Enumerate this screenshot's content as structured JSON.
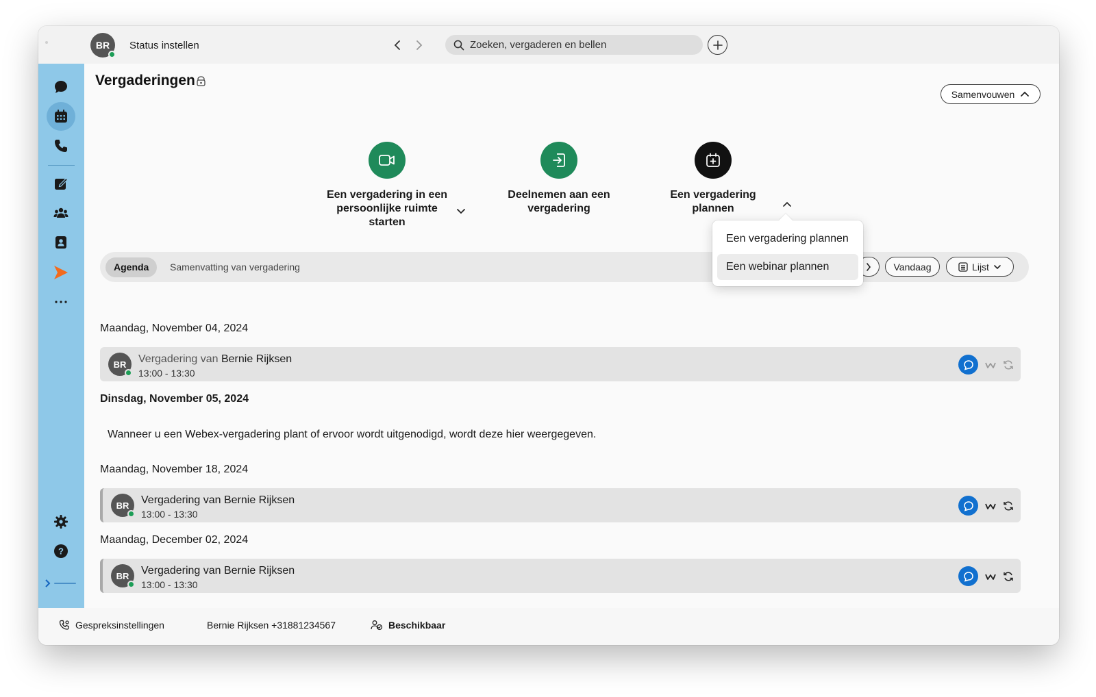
{
  "titlebar": {
    "avatar_initials": "BR",
    "status_label": "Status instellen",
    "search_placeholder": "Zoeken, vergaderen en bellen"
  },
  "sidebar": {
    "items": [
      "chat-icon",
      "calendar-icon",
      "phone-icon",
      "whiteboard-icon",
      "teams-icon",
      "contacts-icon",
      "app-icon",
      "more-icon",
      "settings-icon",
      "help-icon",
      "logo"
    ]
  },
  "page": {
    "title": "Vergaderingen",
    "collapse_label": "Samenvouwen"
  },
  "actions": [
    {
      "label": "Een vergadering in een persoonlijke ruimte starten",
      "color": "#1f8a5a"
    },
    {
      "label": "Deelnemen aan een vergadering",
      "color": "#1f8a5a"
    },
    {
      "label": "Een vergadering plannen",
      "color": "#111111"
    }
  ],
  "tabs": {
    "agenda": "Agenda",
    "summary": "Samenvatting van vergadering",
    "today": "Vandaag",
    "view": "Lijst"
  },
  "dropdown": {
    "items": [
      "Een vergadering plannen",
      "Een webinar plannen"
    ],
    "highlighted": "Een webinar plannen"
  },
  "agenda": {
    "days": [
      {
        "date": "Maandag, November 04, 2024",
        "meetings": [
          {
            "initials": "BR",
            "title_prefix": "Vergadering van",
            "host": "Bernie Rijksen",
            "time": "13:00  -  13:30"
          }
        ]
      },
      {
        "date": "Dinsdag, November 05, 2024",
        "empty": "Wanneer u een Webex-vergadering plant of ervoor wordt uitgenodigd, wordt deze hier weergegeven."
      },
      {
        "date": "Maandag, November 18, 2024",
        "meetings": [
          {
            "initials": "BR",
            "title": "Vergadering van Bernie Rijksen",
            "time": "13:00  -  13:30"
          }
        ]
      },
      {
        "date": "Maandag, December 02, 2024",
        "meetings": [
          {
            "initials": "BR",
            "title": "Vergadering van Bernie Rijksen",
            "time": "13:00  -  13:30"
          }
        ]
      }
    ]
  },
  "footer": {
    "call_settings": "Gespreksinstellingen",
    "user_number": "Bernie Rijksen +31881234567",
    "availability": "Beschikbaar"
  },
  "colors": {
    "sidebar": "#8ec8e8",
    "accent_blue": "#1170cf",
    "green": "#1f8a5a"
  }
}
